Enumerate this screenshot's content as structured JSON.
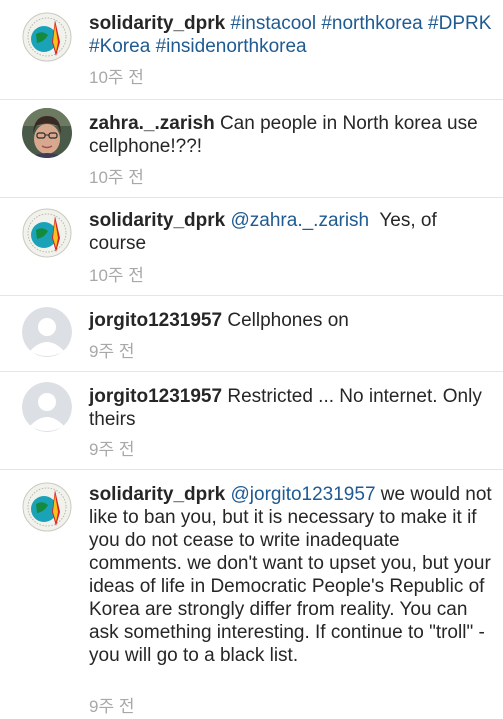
{
  "comments": [
    {
      "username": "solidarity_dprk",
      "segments": [
        {
          "text": "#instacool",
          "kind": "tag"
        },
        {
          "text": " ",
          "kind": "text"
        },
        {
          "text": "#northkorea",
          "kind": "tag"
        },
        {
          "text": " ",
          "kind": "text"
        },
        {
          "text": "#DPRK",
          "kind": "tag"
        },
        {
          "text": " ",
          "kind": "text"
        },
        {
          "text": "#Korea",
          "kind": "tag"
        },
        {
          "text": " ",
          "kind": "text"
        },
        {
          "text": "#insidenorthkorea",
          "kind": "tag"
        }
      ],
      "time": "10주 전",
      "avatar": "emblem"
    },
    {
      "username": "zahra._.zarish",
      "segments": [
        {
          "text": "Can people in North korea use cellphone!??!",
          "kind": "text"
        }
      ],
      "time": "10주 전",
      "avatar": "photo"
    },
    {
      "username": "solidarity_dprk",
      "segments": [
        {
          "text": "@zahra._.zarish",
          "kind": "mention"
        },
        {
          "text": "  Yes, of course",
          "kind": "text"
        }
      ],
      "time": "10주 전",
      "avatar": "emblem"
    },
    {
      "username": "jorgito1231957",
      "segments": [
        {
          "text": "Cellphones on",
          "kind": "text"
        }
      ],
      "time": "9주 전",
      "avatar": "default"
    },
    {
      "username": "jorgito1231957",
      "segments": [
        {
          "text": "Restricted ... No internet. Only theirs",
          "kind": "text"
        }
      ],
      "time": "9주 전",
      "avatar": "default"
    },
    {
      "username": "solidarity_dprk",
      "segments": [
        {
          "text": "@jorgito1231957",
          "kind": "mention"
        },
        {
          "text": " we would not like to ban you, but it is necessary to make it if you do not cease to write inadequate comments. we don't want to upset you, but your ideas of life in Democratic People's Republic of Korea are strongly differ from reality. You can ask something interesting. If continue to \"troll\" - you will go to a black list.",
          "kind": "text"
        }
      ],
      "time": "9주 전",
      "avatar": "emblem"
    }
  ],
  "colors": {
    "text": "#262626",
    "link": "#1f5a91",
    "timestamp": "#a8a8a8",
    "divider": "#e5e5e5"
  }
}
